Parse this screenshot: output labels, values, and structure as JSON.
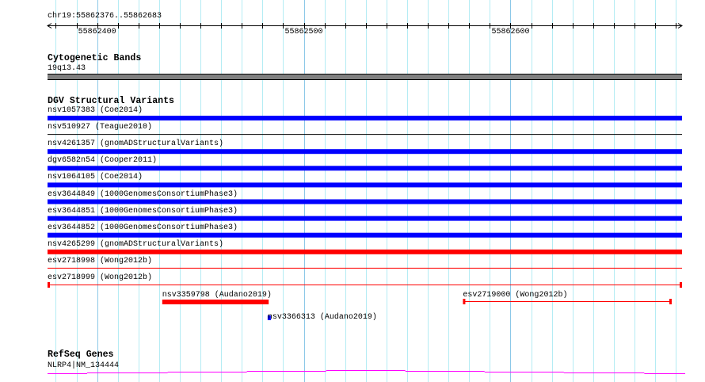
{
  "region": {
    "label": "chr19:55862376..55862683",
    "start": 55862376,
    "end": 55862683
  },
  "ruler": {
    "major_labels": [
      "55862400",
      "55862500",
      "55862600"
    ],
    "major_values": [
      55862400,
      55862500,
      55862600
    ]
  },
  "tracks": {
    "cytoband": {
      "title": "Cytogenetic Bands",
      "band": "19q13.43",
      "color": "#808080"
    },
    "dgv": {
      "title": "DGV Structural Variants",
      "rows": [
        {
          "label": "nsv1057383 (Coe2014)",
          "style": "thick",
          "color": "#0000ff"
        },
        {
          "label": "nsv510927 (Teague2010)",
          "style": "thin",
          "color": "#000000"
        },
        {
          "label": "nsv4261357 (gnomADStructuralVariants)",
          "style": "thick",
          "color": "#0000ff"
        },
        {
          "label": "dgv6582n54 (Cooper2011)",
          "style": "thick",
          "color": "#0000ff"
        },
        {
          "label": "nsv1064105 (Coe2014)",
          "style": "thick",
          "color": "#0000ff"
        },
        {
          "label": "esv3644849 (1000GenomesConsortiumPhase3)",
          "style": "thick",
          "color": "#0000ff"
        },
        {
          "label": "esv3644851 (1000GenomesConsortiumPhase3)",
          "style": "thick",
          "color": "#0000ff"
        },
        {
          "label": "esv3644852 (1000GenomesConsortiumPhase3)",
          "style": "thick",
          "color": "#0000ff"
        },
        {
          "label": "nsv4265299 (gnomADStructuralVariants)",
          "style": "thick",
          "color": "#ff0000"
        },
        {
          "label": "esv2718998 (Wong2012b)",
          "style": "thin",
          "color": "#ff0000"
        },
        {
          "label": "esv2718999 (Wong2012b)",
          "style": "capped",
          "color": "#ff0000"
        }
      ],
      "partial": [
        {
          "label": "nsv3359798 (Audano2019)",
          "start": 55862431.5,
          "end": 55862483,
          "style": "thick",
          "color": "#ff0000"
        },
        {
          "label": "nsv3366313 (Audano2019)",
          "start": 55862482.5,
          "end": 55862484,
          "style": "small",
          "color": "#0000ff"
        },
        {
          "label": "esv2719000 (Wong2012b)",
          "start": 55862577,
          "end": 55862678,
          "style": "capped",
          "color": "#ff0000"
        }
      ]
    },
    "refseq": {
      "title": "RefSeq Genes",
      "gene": "NLRP4|NM_134444",
      "color": "#ff00ff"
    }
  }
}
